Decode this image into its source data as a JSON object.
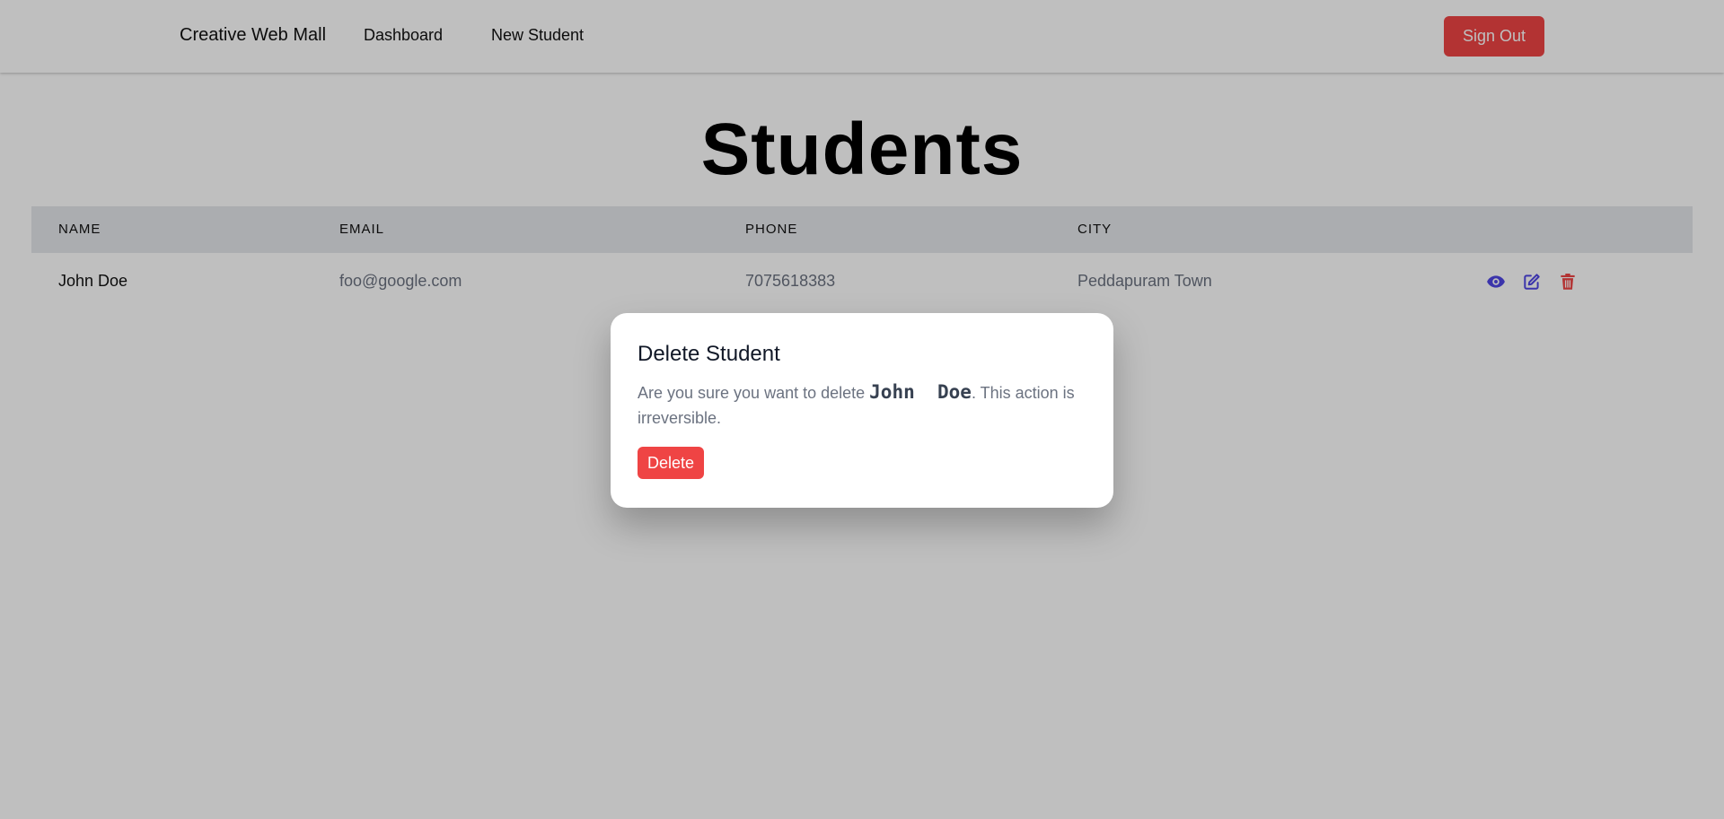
{
  "navbar": {
    "brand": "Creative Web Mall",
    "links": [
      "Dashboard",
      "New Student"
    ],
    "sign_out_label": "Sign Out",
    "sign_out_color": "#ef4444"
  },
  "page_title": "Students",
  "table": {
    "columns": [
      "NAME",
      "EMAIL",
      "PHONE",
      "CITY"
    ],
    "rows": [
      {
        "name": "John Doe",
        "email": "foo@google.com",
        "phone": "7075618383",
        "city": "Peddapuram Town",
        "actions": [
          "view-icon",
          "edit-icon",
          "delete-icon"
        ]
      }
    ]
  },
  "modal": {
    "title": "Delete Student",
    "message_before": "Are you sure you want to delete ",
    "highlight": "John  Doe",
    "message_after": ". This action is irreversible.",
    "delete_label": "Delete",
    "delete_color": "#ef4444"
  },
  "colors": {
    "view_icon": "#4f46e5",
    "edit_icon": "#4f46e5",
    "delete_icon": "#ef4444"
  }
}
